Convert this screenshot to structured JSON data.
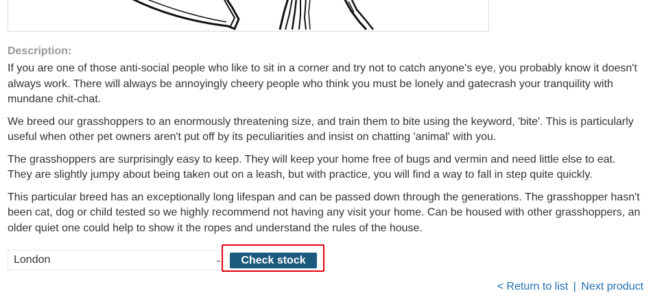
{
  "product": {
    "image_alt": "grasshopper illustration",
    "description_label": "Description:",
    "description_paragraphs": [
      "If you are one of those anti-social people who like to sit in a corner and try not to catch anyone's eye, you probably know it doesn't always work. There will always be annoyingly cheery people who think you must be lonely and gatecrash your tranquility with mundane chit-chat.",
      "We breed our grasshoppers to an enormously threatening size, and train them to bite using the keyword, 'bite'. This is particularly useful when other pet owners aren't put off by its peculiarities and insist on chatting 'animal' with you.",
      "The grasshoppers are surprisingly easy to keep. They will keep your home free of bugs and vermin and need little else to eat. They are slightly jumpy about being taken out on a leash, but with practice, you will find a way to fall in step quite quickly.",
      "This particular breed has an exceptionally long lifespan and can be passed down through the generations. The grasshopper hasn't been cat, dog or child tested so we highly recommend not having any visit your home. Can be housed with other grasshoppers, an older quiet one could help to show it the ropes and understand the rules of the house."
    ]
  },
  "stock_check": {
    "selected_store": "London",
    "arrow_icon": "chevron-down-icon",
    "button_label": "Check stock",
    "highlight_color": "#e3000b",
    "button_color": "#1b5a7c"
  },
  "navigation": {
    "return_link": "< Return to list",
    "separator": "|",
    "next_link": "Next product"
  }
}
